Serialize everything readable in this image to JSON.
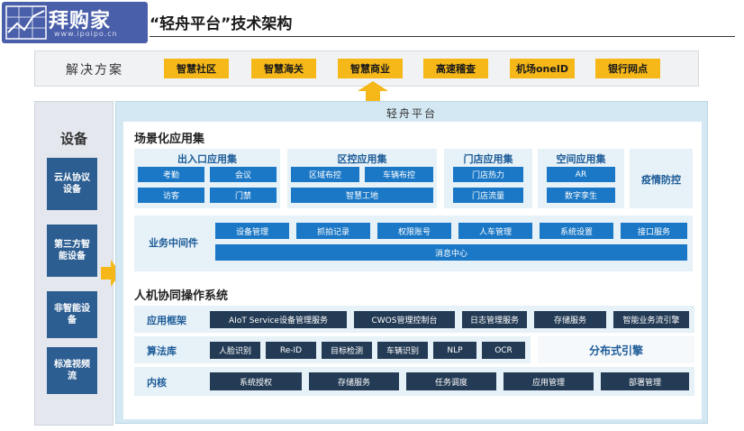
{
  "header": {
    "logo_text": "拜购家",
    "logo_site": "www.ipoipo.cn",
    "title": "“轻舟平台”技术架构"
  },
  "solutions": {
    "title": "解决方案",
    "items": [
      "智慧社区",
      "智慧海关",
      "智慧商业",
      "高速稽查",
      "机场oneID",
      "银行网点"
    ]
  },
  "devices": {
    "title": "设备",
    "items": [
      "云从协议设备",
      "第三方智能设备",
      "非智能设备",
      "标准视频流"
    ]
  },
  "platform": {
    "title": "轻舟平台",
    "scenes": {
      "title": "场景化应用集",
      "groups": [
        {
          "title": "出入口应用集",
          "tiles": [
            "考勤",
            "会议",
            "访客",
            "门禁"
          ]
        },
        {
          "title": "区控应用集",
          "tiles": [
            "区域布控",
            "车辆布控",
            "智慧工地"
          ]
        },
        {
          "title": "门店应用集",
          "tiles": [
            "门店热力",
            "门店流量"
          ]
        },
        {
          "title": "空间应用集",
          "tiles": [
            "AR",
            "数字孪生"
          ]
        }
      ],
      "epidemic": "疫情防控",
      "middleware": {
        "label": "业务中间件",
        "items": [
          "设备管理",
          "抓拍记录",
          "权限账号",
          "人车管理",
          "系统设置",
          "接口服务"
        ],
        "message_center": "消息中心"
      }
    },
    "hmos": {
      "title": "人机协同操作系统",
      "app_framework": {
        "label": "应用框架",
        "items": [
          "AIoT Service设备管理服务",
          "CWOS管理控制台",
          "日志管理服务",
          "存储服务",
          "智能业务流引擎"
        ]
      },
      "algorithms": {
        "label": "算法库",
        "items": [
          "人脸识别",
          "Re-ID",
          "目标检测",
          "车辆识别",
          "NLP",
          "OCR"
        ],
        "distributed": "分布式引擎"
      },
      "kernel": {
        "label": "内核",
        "items": [
          "系统授权",
          "存储服务",
          "任务调度",
          "应用管理",
          "部署管理"
        ]
      }
    }
  },
  "colors": {
    "accent_yellow": "#f6b818",
    "device_blue": "#2d5e92",
    "tile_blue": "#1b78c6",
    "dark_navy": "#243b55",
    "platform_bg": "#d4e8f3"
  }
}
